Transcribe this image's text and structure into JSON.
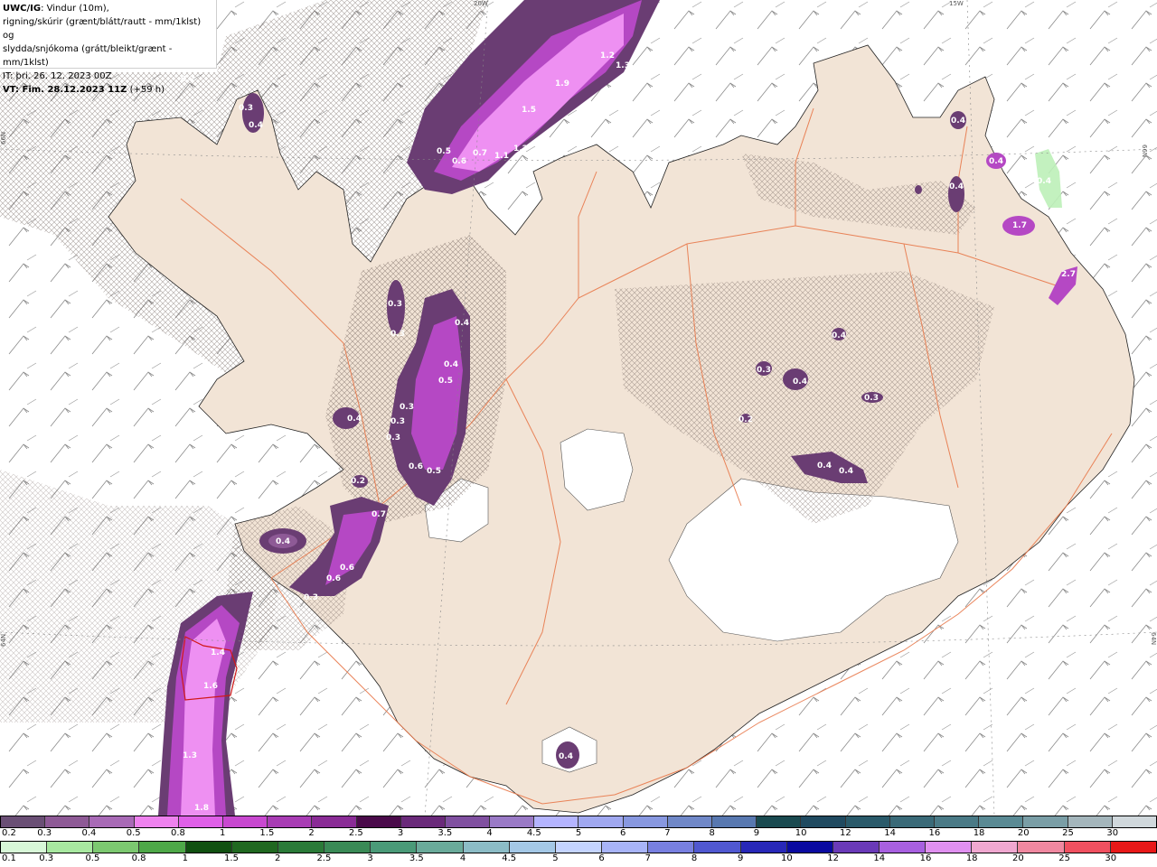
{
  "header": {
    "model": "UWC/IG",
    "line1_rest": ": Vindur (10m),",
    "line2": "rigning/skúrir (grænt/blátt/rautt - mm/1klst) og",
    "line3": "slydda/snjókoma (grátt/bleikt/grænt - mm/1klst)",
    "issue_time": "IT: þri. 26. 12. 2023 00Z",
    "valid_time": "VT: Fim. 28.12.2023 11Z",
    "lead": "(+59 h)"
  },
  "lat_lon_labels": {
    "top_20w": "20W",
    "top_15w": "15W",
    "left_66n": "66N",
    "right_66n": "66N",
    "left_64n": "64N",
    "right_64n": "64N"
  },
  "precip_labels": [
    "0.2",
    "0.3",
    "0.4",
    "1.2",
    "1.3",
    "1.9",
    "1.5",
    "1.2",
    "1.1",
    "0.7",
    "0.6",
    "0.5",
    "0.3",
    "0.3",
    "0.4",
    "0.4",
    "0.5",
    "0.4",
    "0.3",
    "0.3",
    "0.3",
    "0.6",
    "0.5",
    "0.2",
    "0.7",
    "0.4",
    "0.6",
    "0.6",
    "0.3",
    "1.4",
    "1.6",
    "1.3",
    "1.8",
    "0.4",
    "0.3",
    "0.4",
    "0.3",
    "0.2",
    "0.4",
    "0.4",
    "0.4",
    "0.4",
    "0.4",
    "1.7",
    "0.4",
    "0.4",
    "2.7"
  ],
  "colors": {
    "land": "#f2e4d6",
    "sea": "#ffffff",
    "roads": "#e8784a",
    "precip_light": "#ee90f2",
    "precip_mid": "#b548c4",
    "precip_dark": "#6a3d73"
  },
  "scale_snow": {
    "labels": [
      "0.2",
      "0.3",
      "0.4",
      "0.5",
      "0.8",
      "1",
      "1.5",
      "2",
      "2.5",
      "3",
      "3.5",
      "4",
      "4.5",
      "5",
      "6",
      "7",
      "8",
      "9",
      "10",
      "12",
      "14",
      "16",
      "18",
      "20",
      "25",
      "30"
    ],
    "colors": [
      "#6a4f75",
      "#8e5a96",
      "#a86ab6",
      "#ee82ee",
      "#e060e8",
      "#c848d0",
      "#a83cb4",
      "#8a2c96",
      "#4a0a4a",
      "#6a2a7a",
      "#8050a0",
      "#9a7ac6",
      "#b4b4ff",
      "#a0a8f0",
      "#8898e0",
      "#7088c8",
      "#5878b0",
      "#1a4a50",
      "#204a60",
      "#2a5a6a",
      "#3a6a78",
      "#4a7a86",
      "#5a8a94",
      "#7a9ea6",
      "#a4b6bc",
      "#d0d8dc"
    ]
  },
  "scale_rain": {
    "labels": [
      "0.1",
      "0.3",
      "0.5",
      "0.8",
      "1",
      "1.5",
      "2",
      "2.5",
      "3",
      "3.5",
      "4",
      "4.5",
      "5",
      "6",
      "7",
      "8",
      "9",
      "10",
      "12",
      "14",
      "16",
      "18",
      "20",
      "25",
      "30"
    ],
    "colors": [
      "#d8f8d8",
      "#a8e8a0",
      "#7cc870",
      "#4ea848",
      "#105010",
      "#206820",
      "#2a7a38",
      "#3a8a56",
      "#4a9a78",
      "#6aaa9a",
      "#8cbcc6",
      "#a4c8e6",
      "#c4d4ff",
      "#a8b4f8",
      "#7880e0",
      "#5058d0",
      "#2828b8",
      "#0a0aa0",
      "#6a3ab8",
      "#a860e0",
      "#e090f0",
      "#f0a8d0",
      "#f088a0",
      "#f05060",
      "#e81818"
    ]
  }
}
